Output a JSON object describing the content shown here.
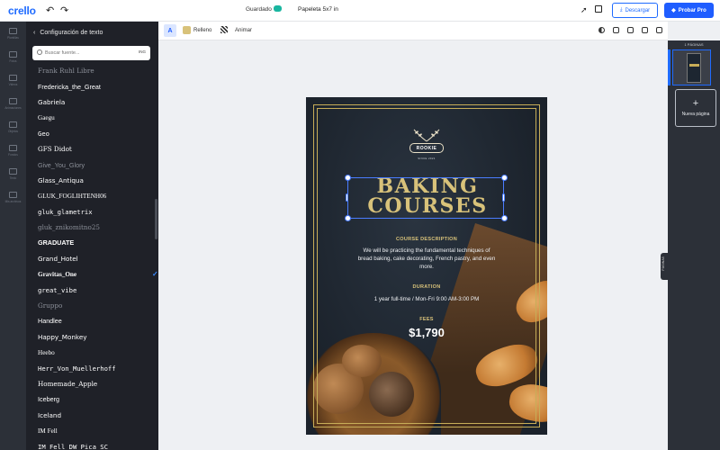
{
  "app": {
    "logo": "crello",
    "undo_icon": "undo-icon",
    "redo_icon": "redo-icon"
  },
  "topbar": {
    "saved_status": "Guardado",
    "doc_title": "Papeleta 5x7 in",
    "download_label": "Descargar",
    "pro_label": "Probar Pro"
  },
  "rail": {
    "items": [
      {
        "icon": "template-icon",
        "label": "Plantillas"
      },
      {
        "icon": "photo-icon",
        "label": "Fotos"
      },
      {
        "icon": "video-icon",
        "label": "Videos"
      },
      {
        "icon": "animation-icon",
        "label": "Animaciones"
      },
      {
        "icon": "objects-icon",
        "label": "Objetos"
      },
      {
        "icon": "background-icon",
        "label": "Fondos"
      },
      {
        "icon": "text-icon",
        "label": "Texto"
      },
      {
        "icon": "upload-icon",
        "label": "Mis archivos"
      }
    ]
  },
  "fontpanel": {
    "title": "Configuración de texto",
    "search_placeholder": "Buscar fuente...",
    "search_badge": "ING",
    "fonts": [
      {
        "name": "Frank Ruhl Libre",
        "dim": true
      },
      {
        "name": "Fredericka_the_Great",
        "dim": false
      },
      {
        "name": "Gabriela",
        "dim": false
      },
      {
        "name": "Gaegu",
        "dim": false
      },
      {
        "name": "Geo",
        "dim": false
      },
      {
        "name": "GFS Didot",
        "dim": false
      },
      {
        "name": "Give_You_Glory",
        "dim": true
      },
      {
        "name": "Glass_Antiqua",
        "dim": false
      },
      {
        "name": "GLUK_FOGLIHTENH06",
        "dim": false
      },
      {
        "name": "gluk_glametrix",
        "dim": false
      },
      {
        "name": "gluk_znikomitno25",
        "dim": true
      },
      {
        "name": "GRADUATE",
        "dim": false
      },
      {
        "name": "Grand_Hotel",
        "dim": false
      },
      {
        "name": "Gravitas_One",
        "dim": false,
        "selected": true
      },
      {
        "name": "great_vibe",
        "dim": false
      },
      {
        "name": "Gruppo",
        "dim": true
      },
      {
        "name": "Handlee",
        "dim": false
      },
      {
        "name": "Happy_Monkey",
        "dim": false
      },
      {
        "name": "Heebo",
        "dim": false
      },
      {
        "name": "Herr_Von_Muellerhoff",
        "dim": false
      },
      {
        "name": "Homemade_Apple",
        "dim": false
      },
      {
        "name": "Iceberg",
        "dim": false
      },
      {
        "name": "Iceland",
        "dim": false
      },
      {
        "name": "IM Fell",
        "dim": false
      },
      {
        "name": "IM_Fell_DW_Pica_SC",
        "dim": false
      }
    ]
  },
  "toolbar": {
    "font_button": "A",
    "fill_label": "Relleno",
    "animate_label": "Animar",
    "fill_color": "#d8c27a"
  },
  "pages": {
    "label": "1 PÁGINAS",
    "new_page_label": "Nueva página",
    "tab_label": "PÁGINAS"
  },
  "poster": {
    "brand": "ROOKIE",
    "since": "SINCE 2021",
    "headline_line1": "BAKING",
    "headline_line2": "COURSES",
    "desc_title": "COURSE DESCRIPTION",
    "desc_body": "We will be practicing the fundamental techniques of bread baking, cake decorating, French pastry, and even more.",
    "duration_title": "DURATION",
    "duration_body": "1 year full-time / Mon-Fri 9:00 AM-3:00 PM",
    "fees_title": "FEES",
    "fees_value": "$1,790",
    "accent_color": "#c7ad58"
  }
}
